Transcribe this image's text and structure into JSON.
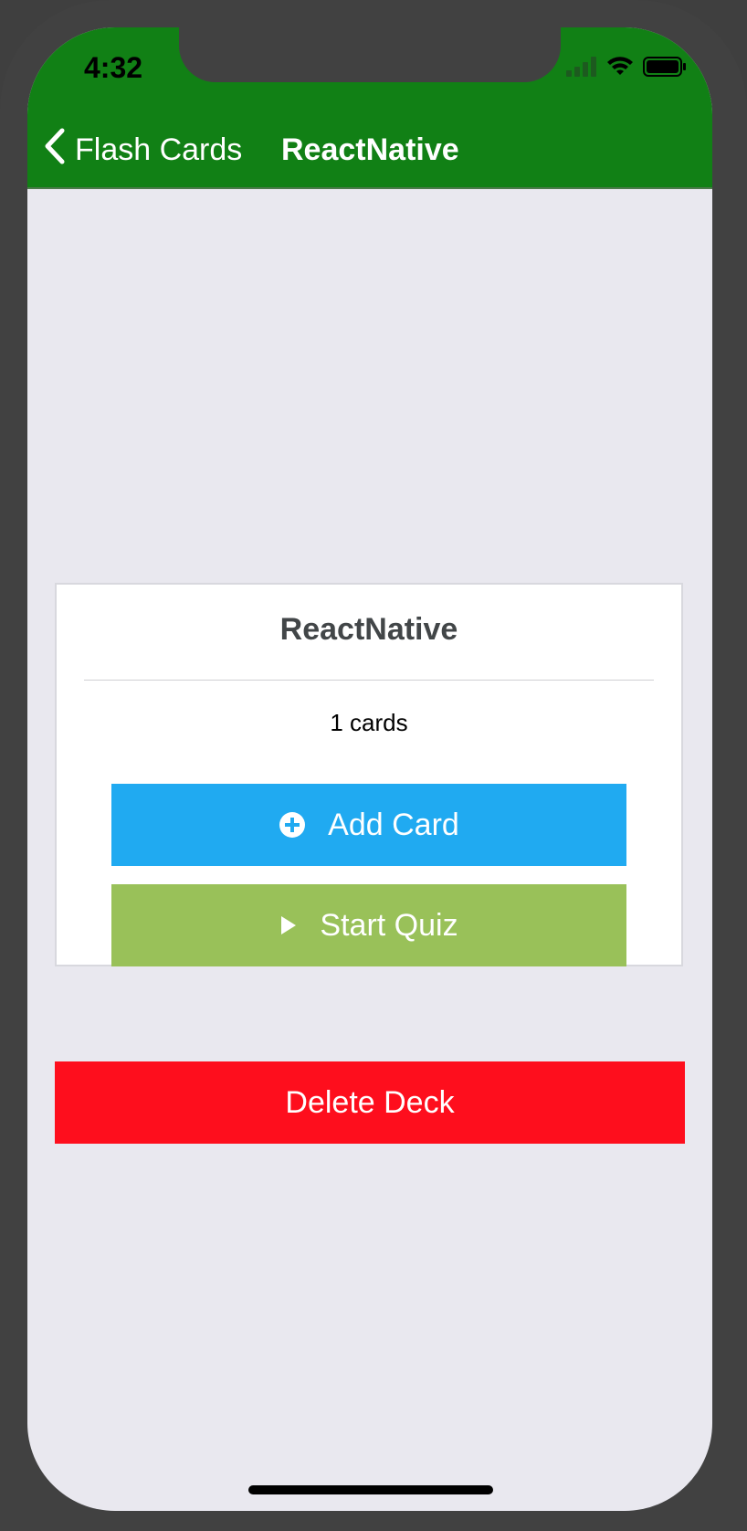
{
  "status_bar": {
    "time": "4:32",
    "icons": [
      "cellular-signal-icon",
      "wifi-icon",
      "battery-icon"
    ]
  },
  "nav": {
    "back_label": "Flash Cards",
    "title": "ReactNative",
    "back_icon": "chevron-left-icon"
  },
  "deck": {
    "title": "ReactNative",
    "count_text": "1 cards",
    "add_card": {
      "label": "Add Card",
      "icon": "plus-circle-icon"
    },
    "start_quiz": {
      "label": "Start Quiz",
      "icon": "play-icon"
    }
  },
  "actions": {
    "delete_label": "Delete Deck"
  },
  "colors": {
    "header": "#118015",
    "add_button": "#20aaf1",
    "quiz_button": "#99c159",
    "delete_button": "#fe0e1d",
    "background": "#e9e8ef",
    "device_frame": "#414141"
  }
}
